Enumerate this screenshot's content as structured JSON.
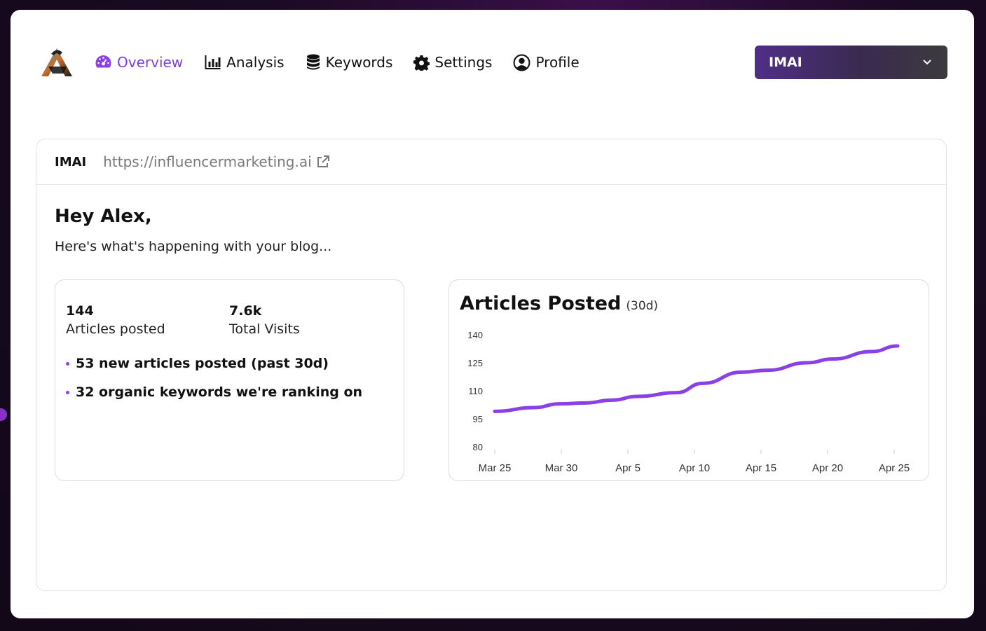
{
  "nav": {
    "items": [
      {
        "label": "Overview",
        "icon": "gauge-icon",
        "active": true
      },
      {
        "label": "Analysis",
        "icon": "bar-chart-icon",
        "active": false
      },
      {
        "label": "Keywords",
        "icon": "database-icon",
        "active": false
      },
      {
        "label": "Settings",
        "icon": "gear-icon",
        "active": false
      },
      {
        "label": "Profile",
        "icon": "user-circle-icon",
        "active": false
      }
    ],
    "site_selector": {
      "value": "IMAI",
      "icon": "chevron-down-icon"
    }
  },
  "site": {
    "name": "IMAI",
    "url": "https://influencermarketing.ai"
  },
  "greeting": "Hey Alex,",
  "subtitle": "Here's what's happening with your blog...",
  "stats": {
    "articles": {
      "value": "144",
      "label": "Articles posted"
    },
    "visits": {
      "value": "7.6k",
      "label": "Total Visits"
    },
    "bullets": [
      "53 new articles posted (past 30d)",
      "32 organic keywords we're ranking on"
    ]
  },
  "colors": {
    "accent": "#8b3fe6",
    "selector_gradient_start": "#4f2f86",
    "selector_gradient_end": "#3b3b3d"
  },
  "chart_data": {
    "type": "line",
    "title": "Articles Posted",
    "period": "(30d)",
    "x_ticks": [
      "Mar 25",
      "Mar 30",
      "Apr 5",
      "Apr 10",
      "Apr 15",
      "Apr 20",
      "Apr 25"
    ],
    "y_ticks": [
      140,
      125,
      110,
      95,
      80
    ],
    "ylim": [
      80,
      140
    ],
    "series": [
      {
        "x": [
          "Mar 25",
          "Mar 28",
          "Mar 30",
          "Apr 1",
          "Apr 3",
          "Apr 5",
          "Apr 8",
          "Apr 10",
          "Apr 13",
          "Apr 15",
          "Apr 18",
          "Apr 20",
          "Apr 23",
          "Apr 25"
        ],
        "values": [
          99,
          101,
          103,
          103.5,
          105,
          107,
          109,
          114,
          120,
          121,
          125,
          127,
          131,
          134
        ],
        "color": "#8b3fe6"
      }
    ],
    "grid": false
  }
}
